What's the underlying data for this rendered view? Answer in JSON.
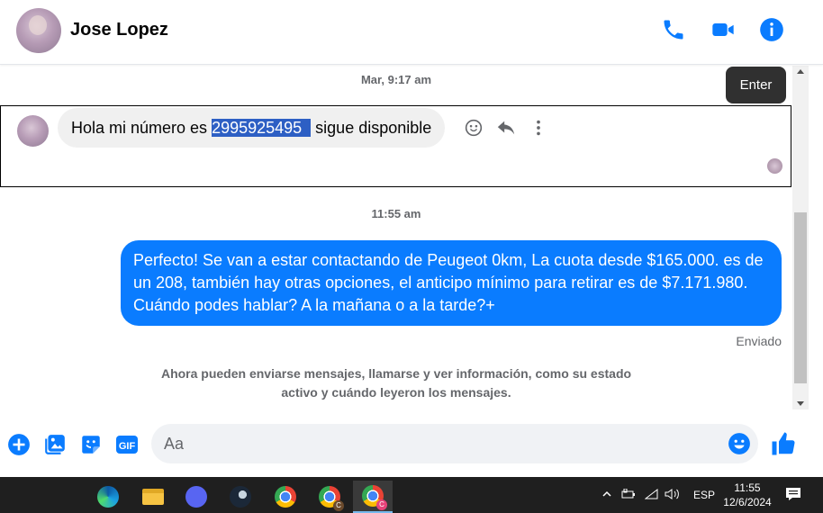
{
  "header": {
    "contact_name": "Jose Lopez",
    "icons": [
      "phone-icon",
      "video-camera-icon",
      "info-icon"
    ]
  },
  "tooltip": {
    "text": "Enter"
  },
  "conversation": {
    "timestamp_1": "Mar, 9:17 am",
    "incoming": {
      "prefix": "Hola mi número es ",
      "highlighted": "2995925495",
      "suffix": " sigue disponible"
    },
    "timestamp_2": "11:55 am",
    "outgoing": {
      "text": "Perfecto!  Se van a estar contactando de Peugeot 0km, La cuota desde $165.000. es de un 208, también hay otras opciones, el anticipo mínimo para retirar es de $7.171.980. Cuándo podes hablar? A la mañana o a la tarde?+"
    },
    "sent_status": "Enviado",
    "notice": "Ahora pueden enviarse mensajes, llamarse y ver información, como su estado activo y cuándo leyeron los mensajes."
  },
  "composer": {
    "placeholder": "Aa",
    "gif_label": "GIF"
  },
  "taskbar": {
    "language": "ESP",
    "time": "11:55",
    "date": "12/6/2024",
    "chrome_badge": "C"
  },
  "colors": {
    "accent": "#0a7cff",
    "highlight": "#2d5fc4"
  }
}
